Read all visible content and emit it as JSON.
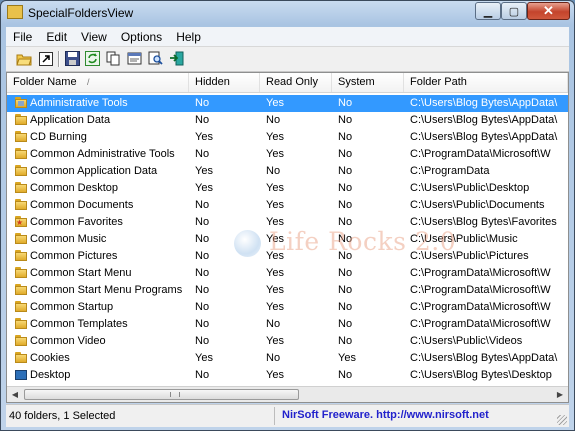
{
  "window": {
    "title": "SpecialFoldersView"
  },
  "menu": [
    "File",
    "Edit",
    "View",
    "Options",
    "Help"
  ],
  "columns": {
    "folder_name": "Folder Name",
    "hidden": "Hidden",
    "read_only": "Read Only",
    "system": "System",
    "folder_path": "Folder Path"
  },
  "rows": [
    {
      "name": "Administrative Tools",
      "hidden": "No",
      "read_only": "Yes",
      "system": "No",
      "path": "C:\\Users\\Blog Bytes\\AppData\\",
      "icon": "tools-folder-icon"
    },
    {
      "name": "Application Data",
      "hidden": "No",
      "read_only": "No",
      "system": "No",
      "path": "C:\\Users\\Blog Bytes\\AppData\\",
      "icon": "folder-icon"
    },
    {
      "name": "CD Burning",
      "hidden": "Yes",
      "read_only": "Yes",
      "system": "No",
      "path": "C:\\Users\\Blog Bytes\\AppData\\",
      "icon": "folder-icon"
    },
    {
      "name": "Common Administrative Tools",
      "hidden": "No",
      "read_only": "Yes",
      "system": "No",
      "path": "C:\\ProgramData\\Microsoft\\W",
      "icon": "folder-icon"
    },
    {
      "name": "Common Application Data",
      "hidden": "Yes",
      "read_only": "No",
      "system": "No",
      "path": "C:\\ProgramData",
      "icon": "folder-icon"
    },
    {
      "name": "Common Desktop",
      "hidden": "Yes",
      "read_only": "Yes",
      "system": "No",
      "path": "C:\\Users\\Public\\Desktop",
      "icon": "folder-icon"
    },
    {
      "name": "Common Documents",
      "hidden": "No",
      "read_only": "Yes",
      "system": "No",
      "path": "C:\\Users\\Public\\Documents",
      "icon": "folder-icon"
    },
    {
      "name": "Common Favorites",
      "hidden": "No",
      "read_only": "Yes",
      "system": "No",
      "path": "C:\\Users\\Blog Bytes\\Favorites",
      "icon": "favorites-folder-icon"
    },
    {
      "name": "Common Music",
      "hidden": "No",
      "read_only": "Yes",
      "system": "No",
      "path": "C:\\Users\\Public\\Music",
      "icon": "folder-icon"
    },
    {
      "name": "Common Pictures",
      "hidden": "No",
      "read_only": "Yes",
      "system": "No",
      "path": "C:\\Users\\Public\\Pictures",
      "icon": "folder-icon"
    },
    {
      "name": "Common Start Menu",
      "hidden": "No",
      "read_only": "Yes",
      "system": "No",
      "path": "C:\\ProgramData\\Microsoft\\W",
      "icon": "folder-icon"
    },
    {
      "name": "Common Start Menu Programs",
      "hidden": "No",
      "read_only": "Yes",
      "system": "No",
      "path": "C:\\ProgramData\\Microsoft\\W",
      "icon": "folder-icon"
    },
    {
      "name": "Common Startup",
      "hidden": "No",
      "read_only": "Yes",
      "system": "No",
      "path": "C:\\ProgramData\\Microsoft\\W",
      "icon": "folder-icon"
    },
    {
      "name": "Common Templates",
      "hidden": "No",
      "read_only": "No",
      "system": "No",
      "path": "C:\\ProgramData\\Microsoft\\W",
      "icon": "folder-icon"
    },
    {
      "name": "Common Video",
      "hidden": "No",
      "read_only": "Yes",
      "system": "No",
      "path": "C:\\Users\\Public\\Videos",
      "icon": "folder-icon"
    },
    {
      "name": "Cookies",
      "hidden": "Yes",
      "read_only": "No",
      "system": "Yes",
      "path": "C:\\Users\\Blog Bytes\\AppData\\",
      "icon": "folder-icon"
    },
    {
      "name": "Desktop",
      "hidden": "No",
      "read_only": "Yes",
      "system": "No",
      "path": "C:\\Users\\Blog Bytes\\Desktop",
      "icon": "desktop-folder-icon"
    }
  ],
  "selected_row": 0,
  "status": {
    "count": "40 folders, 1 Selected",
    "credit": "NirSoft Freeware.  http://www.nirsoft.net"
  },
  "watermark": "Life Rocks 2.0",
  "colors": {
    "selection": "#3399ff",
    "credit_text": "#2222cc"
  }
}
